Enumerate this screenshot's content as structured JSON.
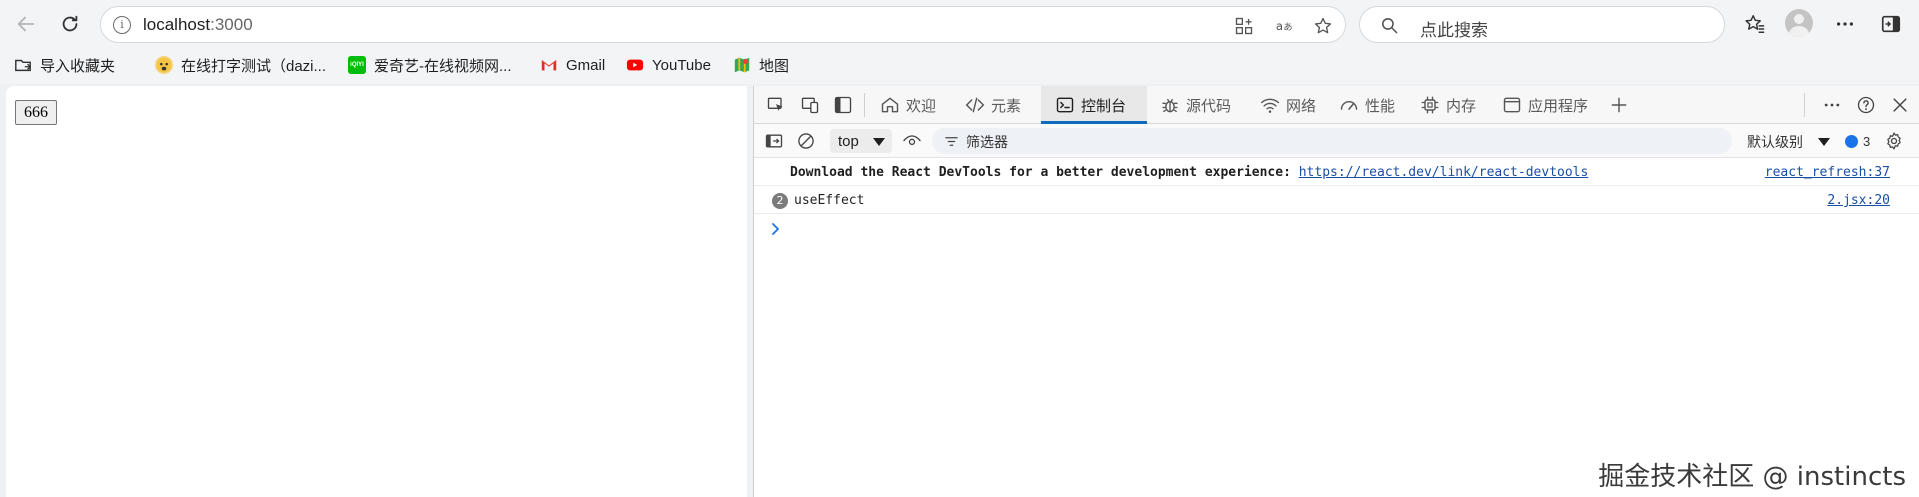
{
  "browser": {
    "address": {
      "host": "localhost",
      "port": ":3000"
    },
    "search": {
      "placeholder": "点此搜索"
    }
  },
  "bookmarks": [
    {
      "label": "导入收藏夹",
      "icon": "folder-icon"
    },
    {
      "label": "在线打字测试（dazi...",
      "icon": "site-favicon"
    },
    {
      "label": "爱奇艺-在线视频网...",
      "icon": "iqiyi-icon",
      "badge": "iQIYI"
    },
    {
      "label": "Gmail",
      "icon": "gmail-icon"
    },
    {
      "label": "YouTube",
      "icon": "youtube-icon"
    },
    {
      "label": "地图",
      "icon": "maps-icon"
    }
  ],
  "page": {
    "button_label": "666"
  },
  "devtools": {
    "tabs": [
      {
        "label": "欢迎",
        "icon": "home-icon"
      },
      {
        "label": "元素",
        "icon": "code-icon"
      },
      {
        "label": "控制台",
        "icon": "console-icon",
        "active": true
      },
      {
        "label": "源代码",
        "icon": "bug-icon"
      },
      {
        "label": "网络",
        "icon": "wifi-icon"
      },
      {
        "label": "性能",
        "icon": "gauge-icon"
      },
      {
        "label": "内存",
        "icon": "chip-icon"
      },
      {
        "label": "应用程序",
        "icon": "app-icon"
      }
    ],
    "toolbar": {
      "context": "top",
      "filter_placeholder": "筛选器",
      "level": "默认级别",
      "issues_count": "3"
    },
    "console": [
      {
        "text": "Download the React DevTools for a better development experience: ",
        "link": "https://react.dev/link/react-devtools",
        "source": "react_refresh:37"
      },
      {
        "count": "2",
        "text": "useEffect",
        "source": "2.jsx:20"
      }
    ]
  },
  "watermark": "掘金技术社区 @ instincts",
  "colors": {
    "accent": "#0f6cbd",
    "link": "#1a4fa6",
    "issue_dot": "#1a73e8"
  }
}
